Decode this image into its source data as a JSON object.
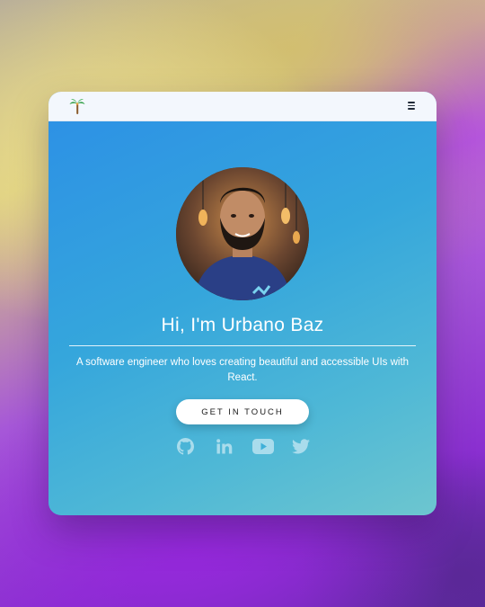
{
  "navbar": {
    "logo_icon": "palm-tree-icon",
    "menu_icon": "hamburger-menu-icon"
  },
  "hero": {
    "avatar_icon": "profile-photo",
    "title": "Hi, I'm Urbano Baz",
    "tagline": "A software engineer who loves creating beautiful and accessible UIs with React.",
    "cta_label": "GET IN TOUCH"
  },
  "socials": [
    {
      "icon": "github-icon"
    },
    {
      "icon": "linkedin-icon"
    },
    {
      "icon": "youtube-icon"
    },
    {
      "icon": "twitter-icon"
    }
  ],
  "colors": {
    "card_gradient_start": "#2c8fe6",
    "card_gradient_end": "#6dc6cf",
    "navbar_bg": "#f3f7fd",
    "social_icon": "#a9dcec"
  }
}
